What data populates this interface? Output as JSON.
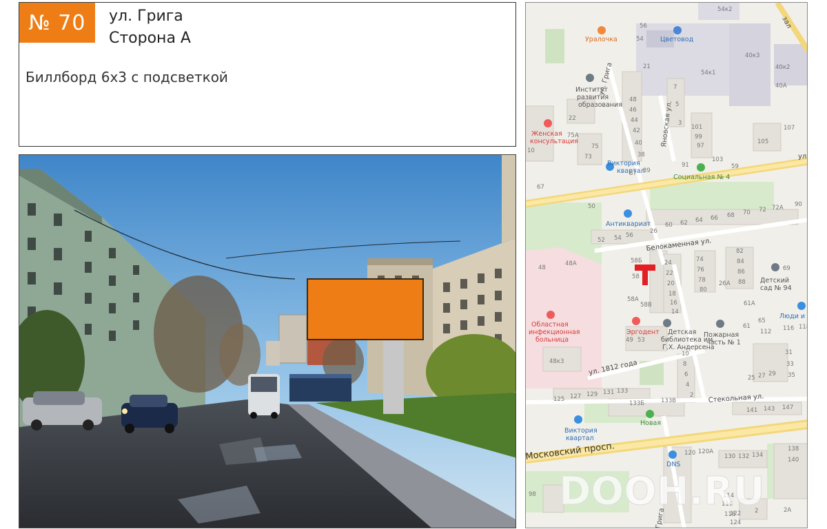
{
  "header": {
    "number": "№ 70",
    "street": "ул. Грига",
    "side": "Сторона А",
    "description": "Биллборд 6х3 с подсветкой"
  },
  "colors": {
    "accent": "#ef7d15",
    "marker": "#e31e24"
  },
  "map": {
    "watermark": "DOOH.RU",
    "streets": {
      "griga": "ул. Грига",
      "yanovskaya": "Яновская ул.",
      "belokamennaya": "Белокаменная ул.",
      "st1812": "ул. 1812 года",
      "stekolnaya": "Стекольная ул.",
      "moskovsky": "Московский просп.",
      "griga_bottom": "Грига",
      "ul_right": "ул",
      "zal": "зал"
    },
    "pois": {
      "uralochka": "Уралочка",
      "tsvetovod": "Цветовод",
      "institute_1": "Институт",
      "institute_2": "развития",
      "institute_3": "образования",
      "zhenskaya_1": "Женская",
      "zhenskaya_2": "консультация",
      "viktoria1_1": "Виктория",
      "viktoria1_2": "квартал",
      "socialnaya": "Социальная № 4",
      "antikvariat": "Антиквариат",
      "oblastnaya_1": "Областная",
      "oblastnaya_2": "инфекционная",
      "oblastnaya_3": "больница",
      "ergodent": "Эргодент",
      "library_1": "Детская",
      "library_2": "библиотека им.",
      "library_3": "Г.Х. Андерсена",
      "pozharnaya_1": "Пожарная",
      "pozharnaya_2": "часть № 1",
      "detsad_1": "Детский",
      "detsad_2": "сад № 94",
      "lyudi": "Люди и к",
      "novaya": "Новая",
      "viktoria2_1": "Виктория",
      "viktoria2_2": "квартал",
      "dns": "DNS"
    },
    "houses": {
      "h54k2": "54к2",
      "h56": "56",
      "h54": "54",
      "h21": "21",
      "h54k1": "54к1",
      "h40k3": "40к3",
      "h40k2": "40к2",
      "h40a": "40А",
      "h48": "48",
      "h46": "46",
      "h44": "44",
      "h42": "42",
      "h40": "40",
      "h38": "38",
      "h7": "7",
      "h5": "5",
      "h3": "3",
      "h101": "101",
      "h99": "99",
      "h97": "97",
      "h107": "107",
      "h105": "105",
      "h103": "103",
      "h22": "22",
      "h75a": "75А",
      "h75": "75",
      "h73": "73",
      "h87": "87",
      "h89": "89",
      "h91": "91",
      "h59": "59",
      "h10": "10",
      "h67": "67",
      "h50": "50",
      "h60": "60",
      "h62": "62",
      "h64": "64",
      "h66": "66",
      "h68": "68",
      "h70": "70",
      "h72": "72",
      "h72a": "72А",
      "h90": "90",
      "h26": "26",
      "h52": "52",
      "h54b": "54",
      "h56b": "56",
      "h48b": "48",
      "h48a": "48А",
      "h58b": "58Б",
      "h58": "58",
      "h58a": "58А",
      "h58v": "58В",
      "h24": "24",
      "h22b": "22",
      "h20": "20",
      "h18": "18",
      "h16": "16",
      "h14": "14",
      "h74": "74",
      "h76": "76",
      "h78": "78",
      "h80": "80",
      "h82": "82",
      "h84": "84",
      "h86": "86",
      "h88": "88",
      "h26a": "26А",
      "h69": "69",
      "h61a": "61А",
      "h61": "61",
      "h65": "65",
      "h112": "112",
      "h116": "116",
      "h118": "118",
      "h49": "49",
      "h53": "53",
      "h48k3": "48к3",
      "h10b": "10",
      "h8": "8",
      "h6": "6",
      "h4": "4",
      "h2": "2",
      "h31": "31",
      "h33": "33",
      "h35": "35",
      "h25": "25",
      "h27": "27",
      "h29": "29",
      "h125": "125",
      "h127": "127",
      "h129": "129",
      "h131": "131",
      "h133": "133",
      "h133b": "133Б",
      "h133v": "133В",
      "h141": "141",
      "h143": "143",
      "h147": "147",
      "h120": "120",
      "h120a": "120А",
      "h130": "130",
      "h132": "132",
      "h134": "134",
      "h138": "138",
      "h140": "140",
      "h114": "114",
      "h116b": "116",
      "h118b": "118",
      "h122": "122",
      "h124": "124",
      "h98": "98",
      "h2a": "2А",
      "h2b": "2"
    }
  }
}
